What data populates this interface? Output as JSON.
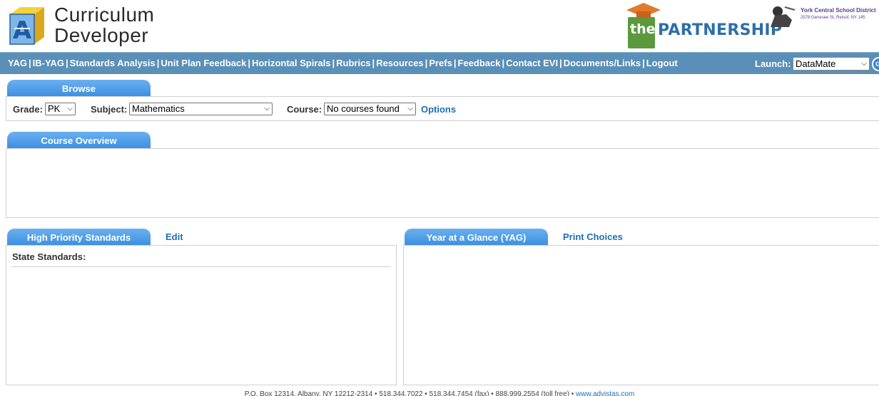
{
  "header": {
    "logo_line1": "Curriculum",
    "logo_line2": "Developer",
    "partner_the": "the",
    "partner_name": "PARTNERSHIP",
    "district_name": "York Central School District",
    "district_addr": "2578 Genesee St, Retsof, NY 145"
  },
  "nav": {
    "items": [
      "YAG",
      "IB-YAG",
      "Standards Analysis",
      "Unit Plan Feedback",
      "Horizontal Spirals",
      "Rubrics",
      "Resources",
      "Prefs",
      "Feedback",
      "Contact EVI",
      "Documents/Links",
      "Logout"
    ],
    "launch_label": "Launch:",
    "launch_value": "DataMate",
    "go_label": "G"
  },
  "browse": {
    "tab": "Browse",
    "grade_label": "Grade:",
    "grade_value": "PK",
    "subject_label": "Subject:",
    "subject_value": "Mathematics",
    "course_label": "Course:",
    "course_value": "No courses found",
    "options_link": "Options"
  },
  "overview": {
    "tab": "Course Overview"
  },
  "standards": {
    "tab": "High Priority Standards",
    "edit_link": "Edit",
    "state_label": "State Standards:"
  },
  "yag": {
    "tab": "Year at a Glance (YAG)",
    "print_link": "Print Choices"
  },
  "footer": {
    "text": "P.O. Box 12314, Albany, NY 12212-2314 • 518.344.7022 • 518.344.7454 (fax) • 888.999.2554 (toll free) • ",
    "link": "www.advistas.com"
  },
  "colors": {
    "navbar": "#5a8fb8",
    "tab": "#3a8de0",
    "link": "#1d6fb5",
    "partner_green": "#5a9a3c",
    "partner_blue": "#2c6fa8"
  }
}
